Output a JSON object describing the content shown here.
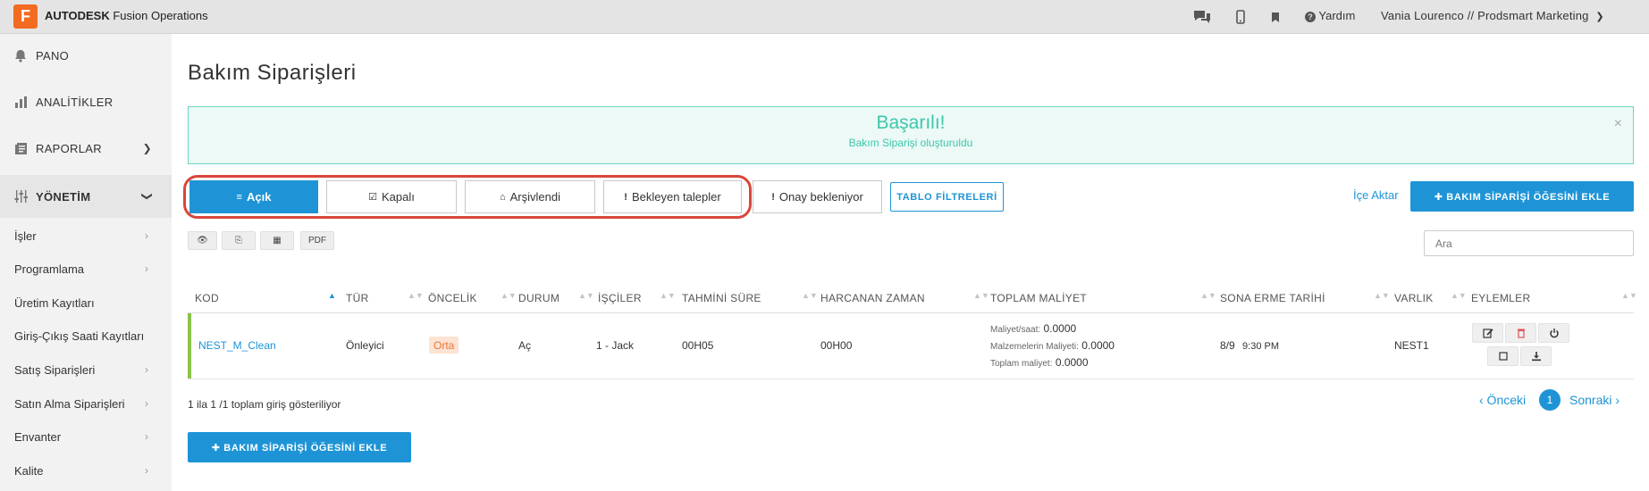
{
  "topbar": {
    "logo_letter": "F",
    "brand_bold": "AUTODESK",
    "brand_rest": "Fusion Operations",
    "help": "Yardım",
    "user": "Vania Lourenco // Prodsmart Marketing",
    "icons": [
      "chat-icon",
      "mobile-icon",
      "bookmark-icon",
      "question-icon",
      "chevron-down-icon"
    ]
  },
  "sidebar": {
    "main": [
      {
        "label": "PANO",
        "icon": "bell-icon"
      },
      {
        "label": "ANALİTİKLER",
        "icon": "bar-chart-icon"
      },
      {
        "label": "RAPORLAR",
        "icon": "report-icon"
      },
      {
        "label": "YÖNETİM",
        "icon": "sliders-icon"
      }
    ],
    "sub": [
      {
        "label": "İşler"
      },
      {
        "label": "Programlama"
      },
      {
        "label": "Üretim Kayıtları"
      },
      {
        "label": "Giriş-Çıkış Saati Kayıtları"
      },
      {
        "label": "Satış Siparişleri"
      },
      {
        "label": "Satın Alma Siparişleri"
      },
      {
        "label": "Envanter"
      },
      {
        "label": "Kalite"
      }
    ]
  },
  "main": {
    "title": "Bakım Siparişleri",
    "alert": {
      "title": "Başarılı!",
      "message": "Bakım Siparişi oluşturuldu",
      "close": "×"
    },
    "tabs": [
      {
        "label": "Açık",
        "glyph": "≡"
      },
      {
        "label": "Kapalı",
        "glyph": "☑"
      },
      {
        "label": "Arşivlendi",
        "glyph": "⌂"
      },
      {
        "label": "Bekleyen talepler",
        "glyph": "!"
      },
      {
        "label": "Onay bekleniyor",
        "glyph": "!"
      }
    ],
    "filter_button": "TABLO FİLTRELERİ",
    "import_link": "İçe Aktar",
    "add_button": "✚ BAKIM SİPARİŞİ ÖĞESİNİ EKLE",
    "small_buttons": [
      "👁",
      "⎘",
      "▦",
      "PDF"
    ],
    "search_placeholder": "Ara"
  },
  "table": {
    "columns": [
      "KOD",
      "TÜR",
      "ÖNCELİK",
      "DURUM",
      "İŞÇİLER",
      "TAHMİNİ SÜRE",
      "HARCANAN ZAMAN",
      "TOPLAM MALİYET",
      "SONA ERME TARİHİ",
      "VARLIK",
      "EYLEMLER"
    ],
    "rows": [
      {
        "code": "NEST_M_Clean",
        "type": "Önleyici",
        "priority": "Orta",
        "status": "Aç",
        "workers": "1 - Jack",
        "estimated": "00H05",
        "spent": "00H00",
        "cost_rate_label": "Maliyet/saat:",
        "cost_rate": "0.0000",
        "material_label": "Malzemelerin Maliyeti:",
        "material_cost": "0.0000",
        "total_label": "Toplam maliyet:",
        "total_cost": "0.0000",
        "due_date": "8/9",
        "due_time": "9:30 PM",
        "asset": "NEST1"
      }
    ],
    "actions": [
      "edit-icon",
      "delete-icon",
      "power-icon",
      "square-icon",
      "download-icon"
    ]
  },
  "footer": {
    "entries": "1 ila 1 /1 toplam giriş gösteriliyor",
    "prev": "‹ Önceki",
    "page": "1",
    "next": "Sonraki ›",
    "add_button": "✚ BAKIM SİPARİŞİ ÖĞESİNİ EKLE"
  },
  "colors": {
    "accent": "#1e94d6",
    "success": "#3dc7ab",
    "highlight": "#d9463a",
    "priority_bg": "#fde3d2",
    "row_marker": "#8bc34a"
  }
}
